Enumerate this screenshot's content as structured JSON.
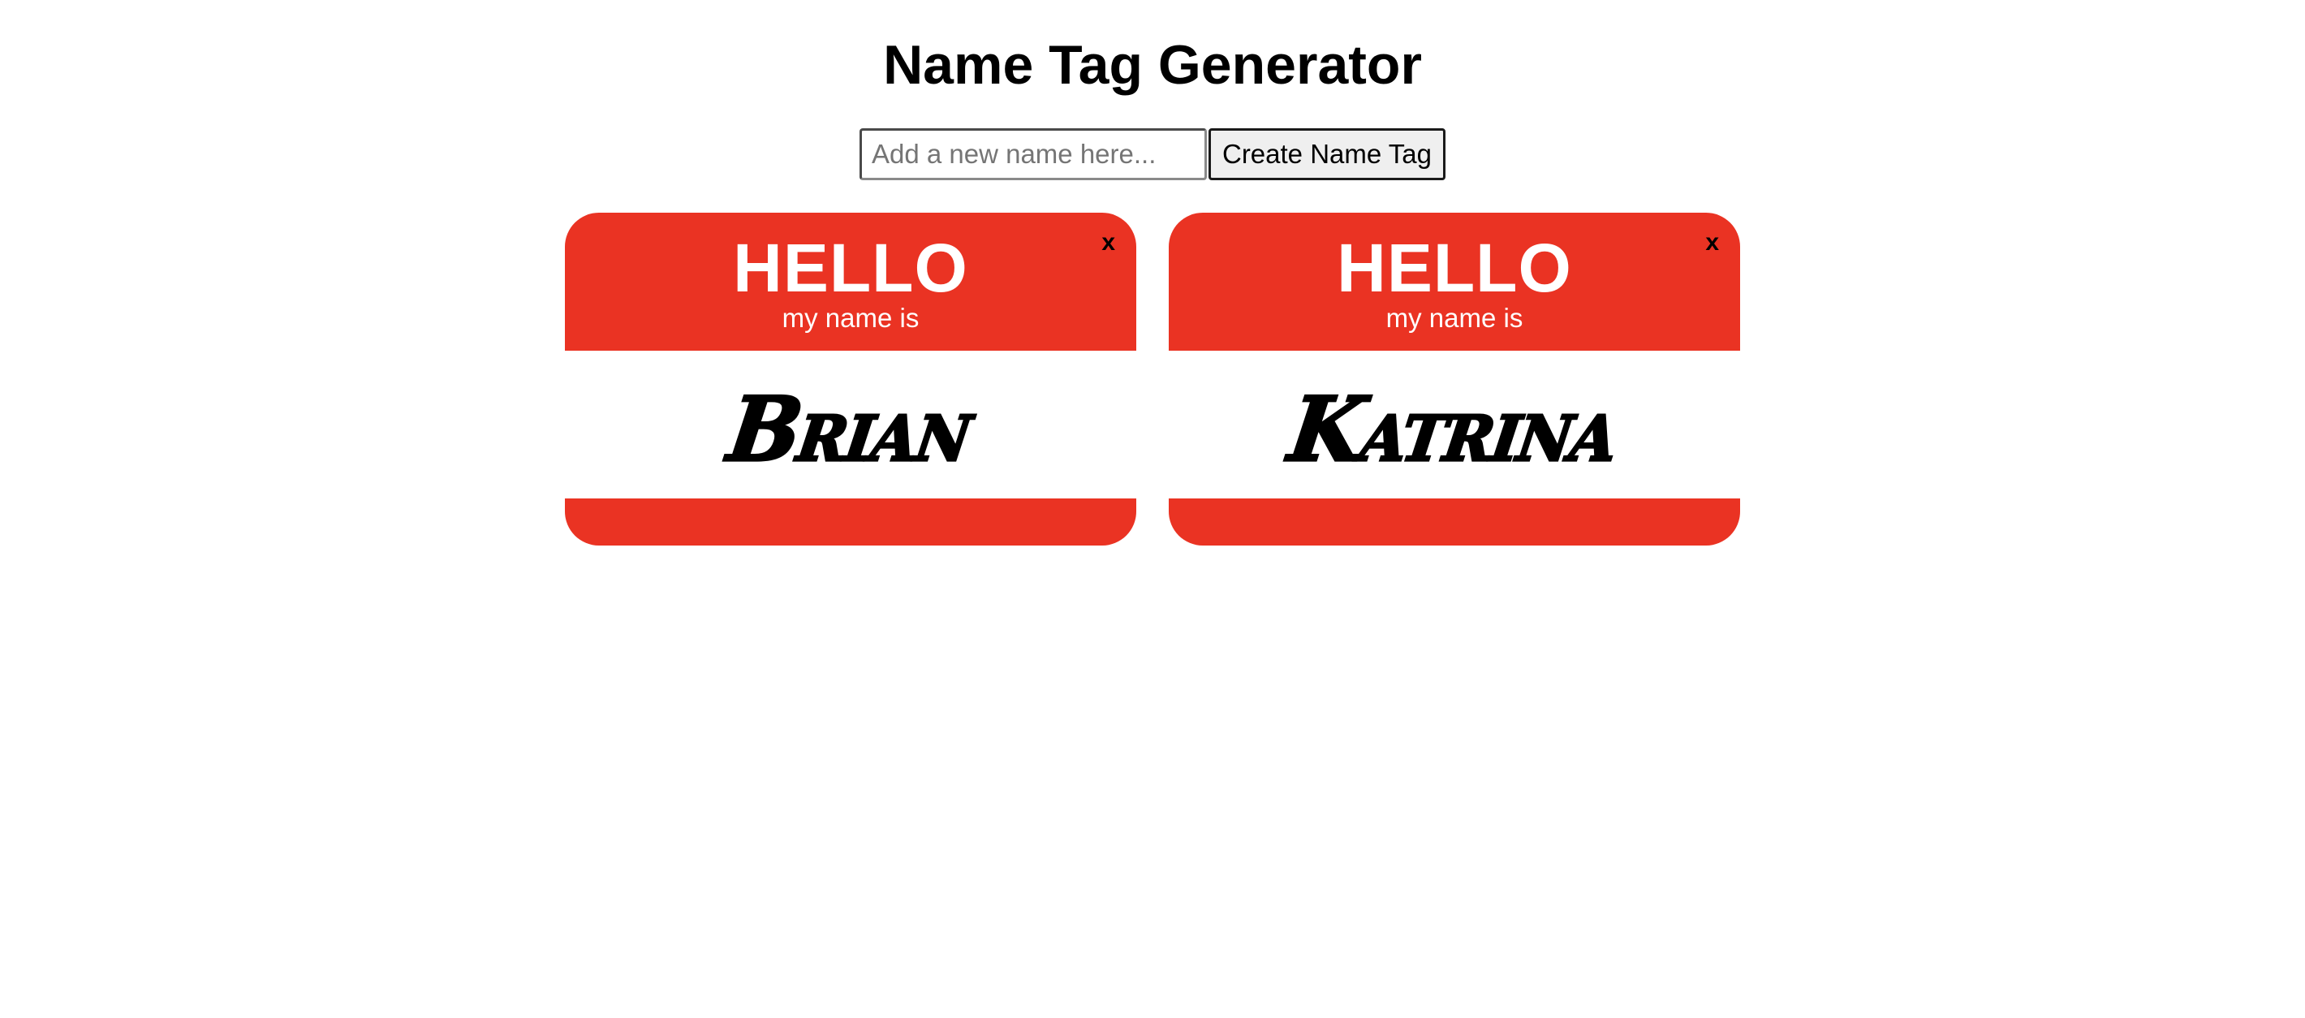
{
  "header": {
    "title": "Name Tag Generator"
  },
  "form": {
    "input_placeholder": "Add a new name here...",
    "input_value": "",
    "button_label": "Create Name Tag"
  },
  "colors": {
    "tag_red": "#ea3323",
    "tag_body": "#ffffff"
  },
  "tags": [
    {
      "hello": "HELLO",
      "subtitle": "my name is",
      "name": "Brian",
      "close_label": "x"
    },
    {
      "hello": "HELLO",
      "subtitle": "my name is",
      "name": "Katrina",
      "close_label": "x"
    }
  ]
}
